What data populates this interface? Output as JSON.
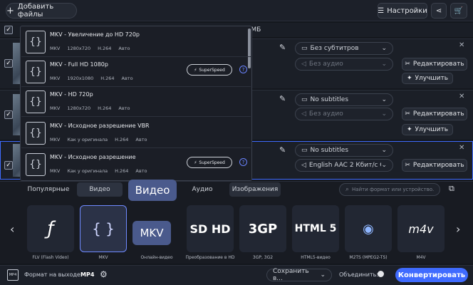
{
  "topbar": {
    "add_files": "Добавить файлы",
    "settings": "Настройки"
  },
  "size_text": "б МБ",
  "rows": [
    {
      "subtitle": "Без субтитров",
      "audio": "Без аудио",
      "edit": "Редактировать",
      "improve": "Улучшить"
    },
    {
      "subtitle": "No subtitles",
      "audio": "Без аудио",
      "edit": "Редактировать",
      "improve": "Улучшить"
    },
    {
      "subtitle": "No subtitles",
      "audio": "English AAC 2 Кбит/с Стерео",
      "edit": "Редактировать"
    }
  ],
  "dropdown": [
    {
      "title": "MKV - Увеличение до HD 720p",
      "c": "MKV",
      "r": "1280x720",
      "v": "H.264",
      "a": "Авто",
      "superspeed": false
    },
    {
      "title": "MKV - Full HD 1080p",
      "c": "MKV",
      "r": "1920x1080",
      "v": "H.264",
      "a": "Авто",
      "superspeed": true
    },
    {
      "title": "MKV - HD 720p",
      "c": "MKV",
      "r": "1280x720",
      "v": "H.264",
      "a": "Авто",
      "superspeed": false
    },
    {
      "title": "MKV - Исходное разрешение VBR",
      "c": "MKV",
      "r": "Как у оригинала",
      "v": "H.264",
      "a": "Авто",
      "superspeed": false
    },
    {
      "title": "MKV - Исходное разрешение",
      "c": "MKV",
      "r": "Как у оригинала",
      "v": "H.264",
      "a": "Авто",
      "superspeed": true
    }
  ],
  "superspeed_label": "SuperSpeed",
  "tabs": {
    "popular": "Популярные",
    "video": "Видео",
    "audio": "Аудио",
    "images": "Изображения"
  },
  "tooltip_video": "Видео",
  "tooltip_mkv": "MKV",
  "search_placeholder": "Найти формат или устройство...",
  "formats": [
    {
      "label": "FLV (Flash Video)",
      "icon": "flash-icon"
    },
    {
      "label": "MKV",
      "icon": "mkv-icon"
    },
    {
      "label": "Онлайн-видео",
      "icon": "online-video-icon"
    },
    {
      "label": "Преобразование в HD",
      "icon": "hd-icon"
    },
    {
      "label": "3GP, 3G2",
      "icon": "3gp-icon"
    },
    {
      "label": "HTML5-видео",
      "icon": "html5-icon"
    },
    {
      "label": "M2TS (MPEG2-TS)",
      "icon": "bluray-icon"
    },
    {
      "label": "M4V",
      "icon": "m4v-icon"
    }
  ],
  "bottom": {
    "output_label": "Формат на выходе:",
    "output_value": "MP4",
    "save": "Сохранить в...",
    "merge": "Объединить:",
    "convert": "Конвертировать"
  },
  "colors": {
    "accent": "#3f6bff",
    "highlight": "#4a5a8c"
  }
}
